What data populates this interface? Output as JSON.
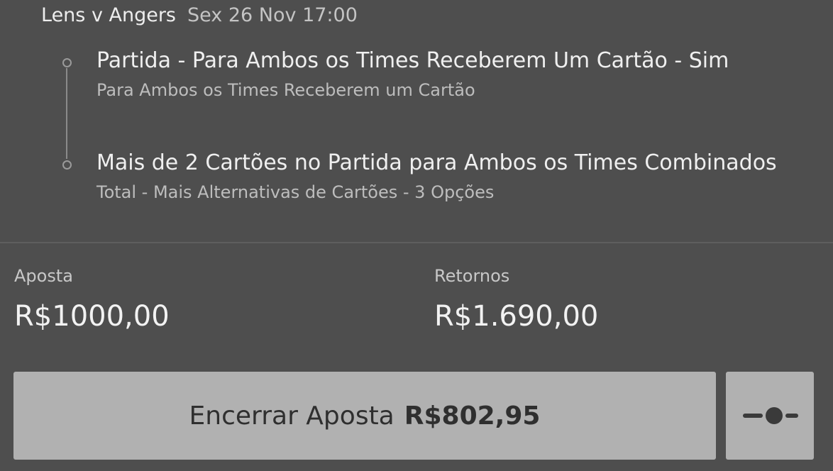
{
  "match": {
    "title": "Lens v Angers",
    "datetime": "Sex 26 Nov 17:00"
  },
  "selections": [
    {
      "title": "Partida - Para Ambos os Times Receberem Um Cartão - Sim",
      "market": "Para Ambos os Times Receberem um Cartão"
    },
    {
      "title": "Mais de 2 Cartões no Partida para Ambos os Times Combinados",
      "market": "Total - Mais Alternativas de Cartões - 3 Opções"
    }
  ],
  "stake": {
    "label": "Aposta",
    "value": "R$1000,00"
  },
  "returns": {
    "label": "Retornos",
    "value": "R$1.690,00"
  },
  "cashout": {
    "label": "Encerrar Aposta",
    "amount": "R$802,95"
  },
  "partial_cashout": {
    "icon": "slider-icon"
  },
  "colors": {
    "background": "#4e4e4e",
    "button": "#b1b1b1",
    "button_text": "#2f2f2f"
  }
}
